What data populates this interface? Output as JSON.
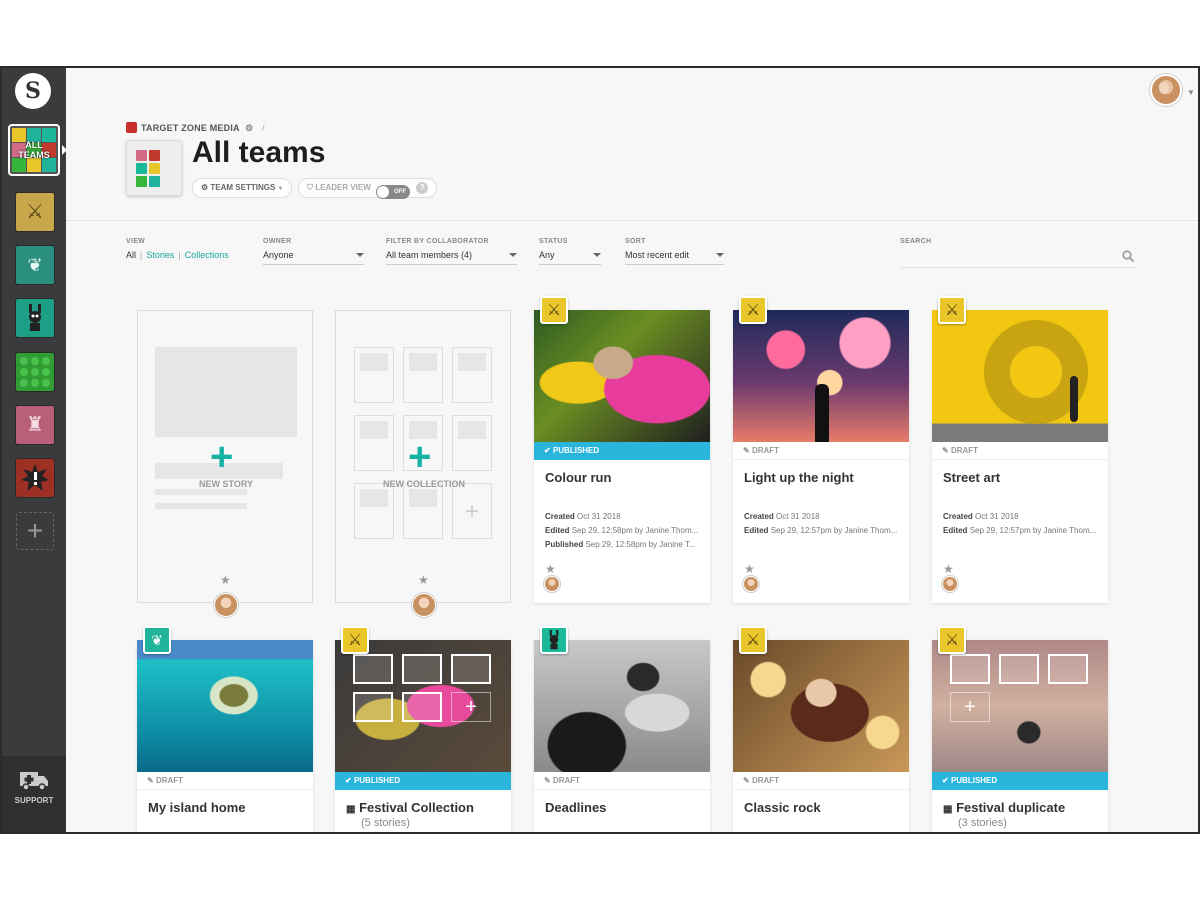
{
  "sidebar": {
    "logo_letter": "S",
    "all_teams_label": "ALL TEAMS",
    "teams": [
      {
        "name": "team-swords",
        "color": "#e9c62a"
      },
      {
        "name": "team-leaf",
        "color": "#22b39b"
      },
      {
        "name": "team-robot",
        "color": "#1cb89a"
      },
      {
        "name": "team-lego",
        "color": "#35b53a"
      },
      {
        "name": "team-castle",
        "color": "#d26b86"
      },
      {
        "name": "team-alert",
        "color": "#c0392b"
      }
    ],
    "support_label": "SUPPORT"
  },
  "header": {
    "org_name": "TARGET ZONE MEDIA",
    "crumb_sep": "/",
    "title": "All teams",
    "team_settings_label": "TEAM SETTINGS",
    "leader_view_label": "LEADER VIEW",
    "toggle_state": "OFF",
    "help": "?"
  },
  "filters": {
    "view_caption": "VIEW",
    "view_all": "All",
    "view_stories": "Stories",
    "view_collections": "Collections",
    "owner_caption": "OWNER",
    "owner_value": "Anyone",
    "collab_caption": "FILTER BY COLLABORATOR",
    "collab_value": "All team members (4)",
    "status_caption": "STATUS",
    "status_value": "Any",
    "sort_caption": "SORT",
    "sort_value": "Most recent edit",
    "search_caption": "SEARCH"
  },
  "placeholders": {
    "new_story": "NEW STORY",
    "new_collection": "NEW COLLECTION"
  },
  "cards_row1": [
    {
      "title": "Colour run",
      "status": "PUBLISHED",
      "created": "Created",
      "created_v": "Oct 31 2018",
      "edited": "Edited",
      "edited_v": "Sep 29, 12:58pm by Janine Thom...",
      "published": "Published",
      "published_v": "Sep 29, 12:58pm by Janine T..."
    },
    {
      "title": "Light up the night",
      "status": "DRAFT",
      "created": "Created",
      "created_v": "Oct 31 2018",
      "edited": "Edited",
      "edited_v": "Sep 29, 12:57pm by Janine Thom..."
    },
    {
      "title": "Street art",
      "status": "DRAFT",
      "created": "Created",
      "created_v": "Oct 31 2018",
      "edited": "Edited",
      "edited_v": "Sep 29, 12:57pm by Janine Thom..."
    }
  ],
  "cards_row2": [
    {
      "title": "My island home",
      "status": "DRAFT"
    },
    {
      "title": "Festival Collection",
      "subtitle": "(5 stories)",
      "status": "PUBLISHED"
    },
    {
      "title": "Deadlines",
      "status": "DRAFT"
    },
    {
      "title": "Classic rock",
      "status": "DRAFT"
    },
    {
      "title": "Festival duplicate",
      "subtitle": "(3 stories)",
      "status": "PUBLISHED"
    }
  ],
  "colors": {
    "accent": "#17a89a",
    "published": "#2ab5dc",
    "sidebar": "#3a3b3d"
  }
}
